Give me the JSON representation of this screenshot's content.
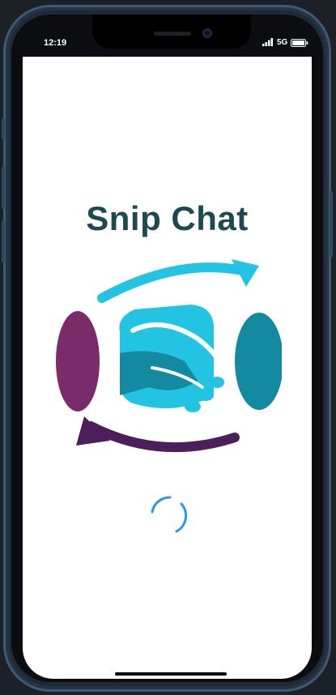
{
  "status_bar": {
    "time": "12:19",
    "network": "5G",
    "icons": [
      "signal-icon",
      "battery-icon"
    ]
  },
  "app": {
    "title": "Snip Chat",
    "logo_icon": "handshake-chat-logo-icon",
    "loading_icon": "loading-spinner-icon"
  },
  "colors": {
    "title": "#1d4a50",
    "logo_cyan": "#22c3e3",
    "logo_teal": "#138aa0",
    "logo_purple": "#7a2c6a",
    "logo_dark_purple": "#4b1f5a",
    "spinner": "#2b95e8",
    "frame": "#3d5a72"
  }
}
